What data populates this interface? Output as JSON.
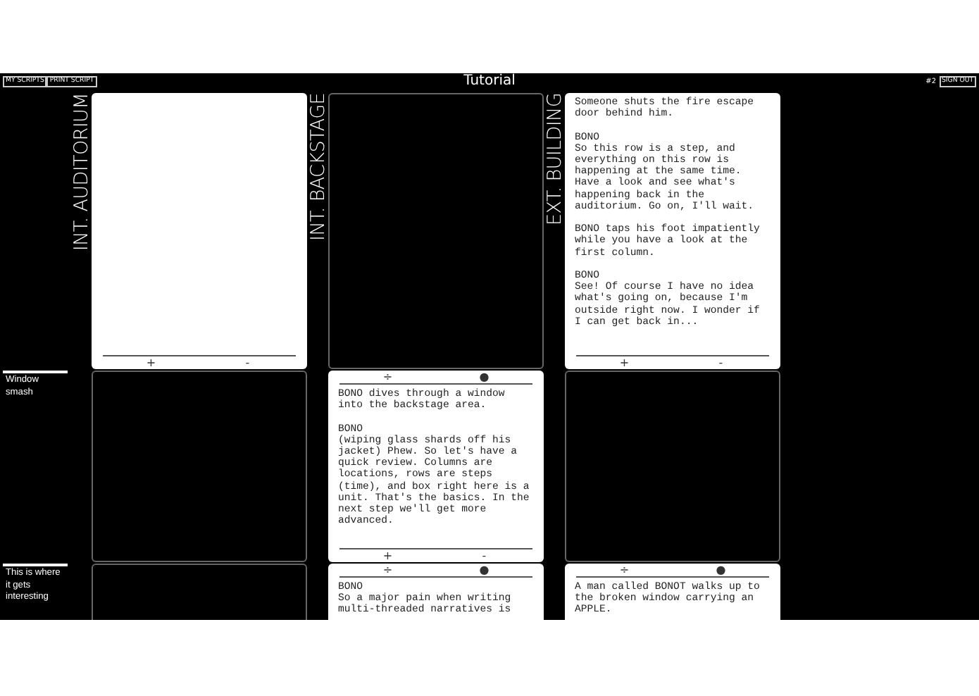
{
  "header": {
    "buttons": [
      "MY SCRIPTS",
      "PRINT SCRIPT"
    ],
    "title": "Tutorial",
    "script_number": "#2",
    "sign_out": "SIGN OUT"
  },
  "columns": [
    {
      "title": "INT. AUDITORIUM"
    },
    {
      "title": "INT. BACKSTAGE"
    },
    {
      "title": "EXT. BUILDING"
    }
  ],
  "rows": [
    {
      "cells": [
        {
          "kind": "unit",
          "bottom": [
            "+",
            "-"
          ]
        },
        {
          "kind": "empty"
        },
        {
          "kind": "unit",
          "text": "Someone shuts the fire escape door behind him.\n\nBONO\nSo this row is a step, and everything on this row is happening at the same time. Have a look and see what's happening back in the auditorium. Go on, I'll wait.\n\nBONO taps his foot impatiently while you have a look at the first column.\n\nBONO\nSee! Of course I have no idea what's going on, because I'm outside right now. I wonder if I can get back in...",
          "bottom": [
            "+",
            "-"
          ]
        }
      ]
    },
    {
      "label": "Window smash",
      "cells": [
        {
          "kind": "empty"
        },
        {
          "kind": "unit",
          "top": [
            "÷",
            "●"
          ],
          "text": "BONO dives through a window into the backstage area.\n\nBONO\n(wiping glass shards off his jacket) Phew. So let's have a quick review. Columns are locations, rows are steps (time), and box right here is a unit. That's the basics. In the next step we'll get more advanced.",
          "bottom": [
            "+",
            "-"
          ]
        },
        {
          "kind": "empty"
        }
      ]
    },
    {
      "label": "This is where it gets interesting",
      "cells": [
        {
          "kind": "empty"
        },
        {
          "kind": "unit",
          "top": [
            "÷",
            "●"
          ],
          "text": "BONO\nSo a major pain when writing\nmulti-threaded narratives is"
        },
        {
          "kind": "unit",
          "top": [
            "÷",
            "●"
          ],
          "text": "A man called BONOT walks up to\nthe broken window carrying an\nAPPLE."
        }
      ]
    }
  ]
}
